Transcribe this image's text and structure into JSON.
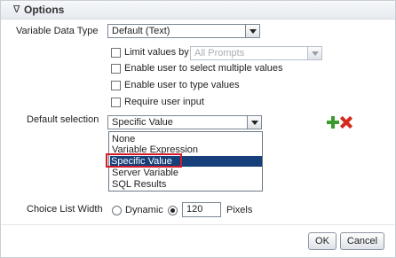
{
  "header": {
    "title": "Options",
    "toggle_icon": "∇"
  },
  "variable_data_type": {
    "label": "Variable Data Type",
    "value": "Default (Text)"
  },
  "checkboxes": {
    "limit_values": {
      "label": "Limit values by",
      "select_value": "All Prompts"
    },
    "multiple_values": {
      "label": "Enable user to select multiple values"
    },
    "type_values": {
      "label": "Enable user to type values"
    },
    "require_input": {
      "label": "Require user input"
    }
  },
  "default_selection": {
    "label": "Default selection",
    "value": "Specific Value",
    "options": [
      "None",
      "Variable Expression",
      "Specific Value",
      "Server Variable",
      "SQL Results"
    ]
  },
  "choice_list_width": {
    "label": "Choice List Width",
    "dynamic_label": "Dynamic",
    "value": "120",
    "unit": "Pixels"
  },
  "buttons": {
    "ok": "OK",
    "cancel": "Cancel"
  },
  "colors": {
    "selected": "#173f7a",
    "highlight": "#d01d2b",
    "add": "#3a9a2b",
    "delete": "#d52a1e"
  }
}
